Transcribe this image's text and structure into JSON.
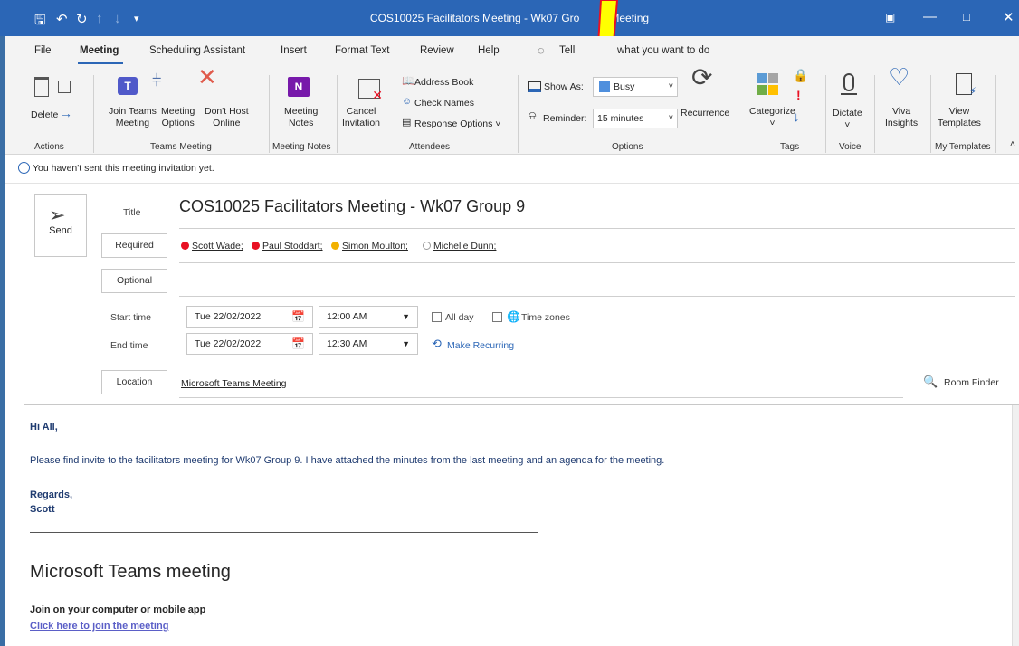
{
  "window": {
    "title": "COS10025 Facilitators Meeting - Wk07 Gro",
    "title_tail": "- Meeting"
  },
  "menu": {
    "items": [
      "File",
      "Meeting",
      "Scheduling Assistant",
      "Insert",
      "Format Text",
      "Review",
      "Help"
    ],
    "tell_me_prefix": "Tell",
    "tell_me_suffix": "what you want to do"
  },
  "ribbon": {
    "delete_label": "Delete",
    "join_teams_label": "Join Teams",
    "join_teams_label2": "Meeting",
    "meeting_options_label": "Meeting",
    "meeting_options_label2": "Options",
    "dont_host_label": "Don't Host",
    "dont_host_label2": "Online",
    "meeting_notes_label": "Meeting",
    "meeting_notes_label2": "Notes",
    "cancel_label": "Cancel",
    "cancel_label2": "Invitation",
    "address_book_label": "Address Book",
    "check_names_label": "Check Names",
    "response_options_label": "Response Options",
    "show_as_label": "Show As:",
    "show_as_value": "Busy",
    "reminder_label": "Reminder:",
    "reminder_value": "15 minutes",
    "recurrence_label": "Recurrence",
    "categorize_label": "Categorize",
    "dictate_label": "Dictate",
    "viva_label": "Viva",
    "viva_label2": "Insights",
    "view_templates_label": "View",
    "view_templates_label2": "Templates",
    "groups": {
      "actions": "Actions",
      "teams_meeting": "Teams Meeting",
      "meeting_notes": "Meeting Notes",
      "attendees": "Attendees",
      "options": "Options",
      "tags": "Tags",
      "voice": "Voice",
      "my_templates": "My Templates"
    }
  },
  "info": {
    "message": "You haven't sent this meeting invitation yet."
  },
  "form": {
    "send_label": "Send",
    "title_label": "Title",
    "title_value": "COS10025 Facilitators Meeting - Wk07 Group 9",
    "required_label": "Required",
    "optional_label": "Optional",
    "attendees": [
      {
        "name": "Scott Wade;",
        "status_color": "#e81123"
      },
      {
        "name": "Paul Stoddart;",
        "status_color": "#e81123"
      },
      {
        "name": "Simon Moulton;",
        "status_color": "#f2b100"
      },
      {
        "name": "Michelle Dunn;",
        "status_color": "#ffffff"
      }
    ],
    "start_time_label": "Start time",
    "end_time_label": "End time",
    "start_date": "Tue 22/02/2022",
    "start_time": "12:00 AM",
    "end_date": "Tue 22/02/2022",
    "end_time": "12:30 AM",
    "all_day_label": "All day",
    "time_zones_label": "Time zones",
    "make_recurring_label": "Make Recurring",
    "location_label": "Location",
    "location_value": "Microsoft Teams Meeting",
    "room_finder_label": "Room Finder"
  },
  "body": {
    "greeting": "Hi All,",
    "line1_a": "Please find invite to the facilitators meeting for Wk07 Group 9.",
    "line1_b": " I have attached the minutes from the last meeting and an agenda for the meeting.",
    "regards": "Regards,",
    "signature": "Scott",
    "teams_heading": "Microsoft Teams meeting",
    "join_label": "Join on your computer or mobile app",
    "join_link": "Click here to join the meeting"
  },
  "colors": {
    "titlebar": "#2b66b6",
    "accent": "#2b66b6",
    "busy_swatch": "#4f8fdd",
    "arrow_yellow": "#ffff00"
  }
}
